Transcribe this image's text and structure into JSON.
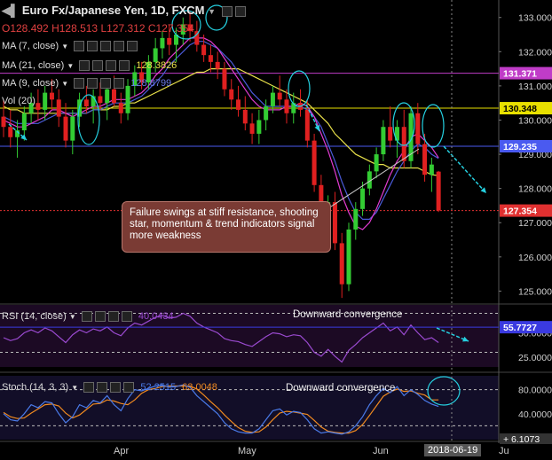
{
  "header": {
    "symbol": "Euro Fx/Japanese Yen, 1D, FXCM",
    "ohlc": {
      "o": "O128.492",
      "h": "H128.513",
      "l": "L127.312",
      "c": "C127.354"
    }
  },
  "indicators": {
    "ma7": {
      "label": "MA (7, close)",
      "color": "#e23bd1"
    },
    "ma21": {
      "label": "MA (21, close)",
      "value": "128.3826",
      "color": "#e8e04a"
    },
    "ma9": {
      "label": "MA (9, close)",
      "value": "128.8799",
      "color": "#4a5ad8"
    },
    "vol": {
      "label": "Vol (20)"
    }
  },
  "annotation_box": "Failure swings at stiff resistance, shooting star, momentum & trend indicators signal more weakness",
  "rsi_panel": {
    "label": "RSI (14, close)",
    "value": "40.0434",
    "caption": "Downward convergence",
    "tag": "55.7727",
    "ticks": [
      "50.0000",
      "25.0000"
    ]
  },
  "stoch_panel": {
    "label": "Stoch (14, 3, 3)",
    "k": "52.2515",
    "d": "63.0048",
    "caption": "Downward convergence",
    "ticks": [
      "80.0000",
      "40.0000"
    ],
    "tag": "6.1073"
  },
  "x_axis": {
    "labels": [
      "Apr",
      "May",
      "Jun",
      "Ju"
    ],
    "cursor_date": "2018-06-19"
  },
  "chart_data": {
    "type": "line",
    "title": "Euro Fx/Japanese Yen, 1D, FXCM",
    "y_ticks": [
      "133.000",
      "132.000",
      "131.000",
      "130.000",
      "129.000",
      "128.000",
      "127.000",
      "126.000",
      "125.000"
    ],
    "ylim": [
      124.7,
      133.2
    ],
    "levels": [
      {
        "label": "131.371",
        "value": 131.371,
        "color": "#c03cc8"
      },
      {
        "label": "130.348",
        "value": 130.348,
        "color": "#e8e000"
      },
      {
        "label": "129.235",
        "value": 129.235,
        "color": "#4a5af0"
      },
      {
        "label": "127.354",
        "value": 127.354,
        "color": "#e03030"
      }
    ],
    "candles": [
      {
        "o": 130.1,
        "h": 130.6,
        "l": 129.5,
        "c": 129.8
      },
      {
        "o": 129.8,
        "h": 130.3,
        "l": 129.2,
        "c": 129.5
      },
      {
        "o": 129.5,
        "h": 130.0,
        "l": 128.9,
        "c": 129.7
      },
      {
        "o": 129.7,
        "h": 130.4,
        "l": 129.4,
        "c": 130.2
      },
      {
        "o": 130.2,
        "h": 130.8,
        "l": 129.9,
        "c": 130.5
      },
      {
        "o": 130.5,
        "h": 130.9,
        "l": 130.0,
        "c": 130.3
      },
      {
        "o": 130.3,
        "h": 131.0,
        "l": 130.0,
        "c": 130.8
      },
      {
        "o": 130.8,
        "h": 131.2,
        "l": 130.3,
        "c": 130.6
      },
      {
        "o": 130.6,
        "h": 130.9,
        "l": 129.8,
        "c": 130.1
      },
      {
        "o": 130.1,
        "h": 130.5,
        "l": 129.2,
        "c": 129.4
      },
      {
        "o": 129.4,
        "h": 130.3,
        "l": 129.0,
        "c": 130.1
      },
      {
        "o": 130.1,
        "h": 130.8,
        "l": 129.8,
        "c": 130.6
      },
      {
        "o": 130.6,
        "h": 131.0,
        "l": 130.2,
        "c": 130.4
      },
      {
        "o": 130.4,
        "h": 130.9,
        "l": 129.9,
        "c": 130.7
      },
      {
        "o": 130.7,
        "h": 131.1,
        "l": 130.3,
        "c": 130.5
      },
      {
        "o": 130.5,
        "h": 131.0,
        "l": 130.0,
        "c": 130.9
      },
      {
        "o": 130.9,
        "h": 131.3,
        "l": 130.4,
        "c": 130.5
      },
      {
        "o": 130.5,
        "h": 130.8,
        "l": 129.9,
        "c": 130.2
      },
      {
        "o": 130.2,
        "h": 131.2,
        "l": 130.0,
        "c": 131.0
      },
      {
        "o": 131.0,
        "h": 131.6,
        "l": 130.7,
        "c": 131.4
      },
      {
        "o": 131.4,
        "h": 131.7,
        "l": 130.9,
        "c": 131.1
      },
      {
        "o": 131.1,
        "h": 131.9,
        "l": 130.9,
        "c": 131.7
      },
      {
        "o": 131.7,
        "h": 132.4,
        "l": 131.4,
        "c": 132.1
      },
      {
        "o": 132.1,
        "h": 132.6,
        "l": 131.8,
        "c": 132.4
      },
      {
        "o": 132.4,
        "h": 132.8,
        "l": 131.9,
        "c": 132.2
      },
      {
        "o": 132.2,
        "h": 132.7,
        "l": 131.7,
        "c": 132.5
      },
      {
        "o": 132.5,
        "h": 133.0,
        "l": 132.2,
        "c": 132.8
      },
      {
        "o": 132.8,
        "h": 133.2,
        "l": 132.3,
        "c": 132.6
      },
      {
        "o": 132.6,
        "h": 132.9,
        "l": 132.0,
        "c": 132.2
      },
      {
        "o": 132.2,
        "h": 132.5,
        "l": 131.7,
        "c": 131.9
      },
      {
        "o": 131.9,
        "h": 132.2,
        "l": 131.4,
        "c": 131.7
      },
      {
        "o": 131.7,
        "h": 132.0,
        "l": 131.2,
        "c": 131.5
      },
      {
        "o": 131.5,
        "h": 131.7,
        "l": 130.7,
        "c": 130.9
      },
      {
        "o": 130.9,
        "h": 131.2,
        "l": 130.3,
        "c": 130.6
      },
      {
        "o": 130.6,
        "h": 131.0,
        "l": 130.1,
        "c": 130.3
      },
      {
        "o": 130.3,
        "h": 130.7,
        "l": 129.7,
        "c": 129.9
      },
      {
        "o": 129.9,
        "h": 130.2,
        "l": 129.3,
        "c": 129.6
      },
      {
        "o": 129.6,
        "h": 130.3,
        "l": 129.3,
        "c": 130.0
      },
      {
        "o": 130.0,
        "h": 130.6,
        "l": 129.7,
        "c": 130.4
      },
      {
        "o": 130.4,
        "h": 131.0,
        "l": 130.2,
        "c": 130.8
      },
      {
        "o": 130.8,
        "h": 131.3,
        "l": 130.4,
        "c": 130.6
      },
      {
        "o": 130.6,
        "h": 130.9,
        "l": 129.9,
        "c": 130.2
      },
      {
        "o": 130.2,
        "h": 130.8,
        "l": 129.9,
        "c": 130.5
      },
      {
        "o": 130.5,
        "h": 130.9,
        "l": 130.1,
        "c": 130.3
      },
      {
        "o": 130.3,
        "h": 130.6,
        "l": 129.2,
        "c": 129.4
      },
      {
        "o": 129.4,
        "h": 129.6,
        "l": 127.9,
        "c": 128.1
      },
      {
        "o": 128.1,
        "h": 128.4,
        "l": 126.9,
        "c": 127.2
      },
      {
        "o": 127.2,
        "h": 127.8,
        "l": 126.6,
        "c": 127.6
      },
      {
        "o": 127.6,
        "h": 127.9,
        "l": 126.2,
        "c": 126.4
      },
      {
        "o": 126.4,
        "h": 126.7,
        "l": 124.8,
        "c": 125.2
      },
      {
        "o": 125.2,
        "h": 127.0,
        "l": 125.0,
        "c": 126.8
      },
      {
        "o": 126.8,
        "h": 127.6,
        "l": 126.5,
        "c": 127.4
      },
      {
        "o": 127.4,
        "h": 128.2,
        "l": 127.2,
        "c": 128.0
      },
      {
        "o": 128.0,
        "h": 128.7,
        "l": 127.8,
        "c": 128.5
      },
      {
        "o": 128.5,
        "h": 129.2,
        "l": 128.3,
        "c": 129.0
      },
      {
        "o": 129.0,
        "h": 130.0,
        "l": 128.8,
        "c": 129.8
      },
      {
        "o": 129.8,
        "h": 130.4,
        "l": 129.2,
        "c": 129.4
      },
      {
        "o": 129.4,
        "h": 130.0,
        "l": 128.9,
        "c": 129.8
      },
      {
        "o": 129.8,
        "h": 130.3,
        "l": 128.6,
        "c": 128.8
      },
      {
        "o": 128.8,
        "h": 130.4,
        "l": 128.6,
        "c": 130.2
      },
      {
        "o": 130.2,
        "h": 130.5,
        "l": 129.0,
        "c": 129.3
      },
      {
        "o": 129.3,
        "h": 129.6,
        "l": 128.2,
        "c": 128.4
      },
      {
        "o": 128.4,
        "h": 128.9,
        "l": 127.9,
        "c": 128.7
      },
      {
        "o": 128.492,
        "h": 128.513,
        "l": 127.312,
        "c": 127.354
      }
    ],
    "ma7": [
      130.0,
      129.9,
      129.8,
      129.8,
      129.9,
      130.0,
      130.1,
      130.3,
      130.3,
      130.2,
      130.1,
      130.2,
      130.3,
      130.4,
      130.4,
      130.5,
      130.6,
      130.6,
      130.6,
      130.7,
      130.8,
      131.0,
      131.3,
      131.5,
      131.8,
      132.0,
      132.2,
      132.4,
      132.4,
      132.4,
      132.3,
      132.1,
      131.8,
      131.5,
      131.2,
      130.9,
      130.6,
      130.4,
      130.3,
      130.3,
      130.3,
      130.4,
      130.4,
      130.5,
      130.4,
      130.1,
      129.6,
      129.1,
      128.5,
      127.8,
      127.3,
      126.9,
      126.8,
      127.0,
      127.4,
      127.9,
      128.4,
      128.8,
      129.1,
      129.5,
      129.6,
      129.4,
      129.2,
      128.9
    ],
    "ma21": [
      130.4,
      130.3,
      130.3,
      130.2,
      130.2,
      130.2,
      130.2,
      130.2,
      130.2,
      130.2,
      130.2,
      130.2,
      130.2,
      130.3,
      130.3,
      130.3,
      130.4,
      130.4,
      130.5,
      130.5,
      130.6,
      130.7,
      130.8,
      130.9,
      131.0,
      131.1,
      131.2,
      131.3,
      131.4,
      131.4,
      131.5,
      131.5,
      131.5,
      131.5,
      131.5,
      131.4,
      131.3,
      131.2,
      131.1,
      131.0,
      130.9,
      130.8,
      130.7,
      130.6,
      130.5,
      130.3,
      130.1,
      129.9,
      129.6,
      129.4,
      129.2,
      129.0,
      128.9,
      128.8,
      128.7,
      128.7,
      128.6,
      128.6,
      128.6,
      128.6,
      128.6,
      128.5,
      128.4,
      128.38
    ],
    "ma9": [
      130.1,
      130.0,
      129.9,
      129.9,
      129.9,
      129.9,
      130.0,
      130.1,
      130.2,
      130.2,
      130.2,
      130.2,
      130.2,
      130.3,
      130.3,
      130.4,
      130.5,
      130.5,
      130.5,
      130.6,
      130.7,
      130.9,
      131.1,
      131.3,
      131.6,
      131.8,
      132.0,
      132.2,
      132.3,
      132.3,
      132.2,
      132.1,
      131.9,
      131.7,
      131.4,
      131.1,
      130.8,
      130.6,
      130.4,
      130.4,
      130.4,
      130.4,
      130.4,
      130.4,
      130.3,
      130.1,
      129.8,
      129.3,
      128.8,
      128.2,
      127.7,
      127.3,
      127.1,
      127.1,
      127.3,
      127.7,
      128.1,
      128.5,
      128.8,
      129.1,
      129.3,
      129.2,
      129.0,
      128.88
    ],
    "rsi": [
      45,
      42,
      44,
      50,
      53,
      50,
      55,
      52,
      46,
      40,
      48,
      53,
      50,
      54,
      52,
      56,
      50,
      47,
      55,
      60,
      58,
      62,
      66,
      68,
      65,
      66,
      70,
      67,
      60,
      56,
      53,
      50,
      44,
      42,
      41,
      38,
      36,
      41,
      46,
      50,
      49,
      46,
      48,
      47,
      40,
      30,
      26,
      33,
      26,
      20,
      32,
      38,
      45,
      50,
      55,
      60,
      52,
      56,
      48,
      58,
      50,
      43,
      45,
      40
    ],
    "stoch_k": [
      40,
      30,
      28,
      40,
      55,
      50,
      60,
      58,
      40,
      25,
      35,
      55,
      50,
      62,
      58,
      70,
      55,
      45,
      65,
      80,
      78,
      82,
      86,
      88,
      84,
      85,
      88,
      84,
      70,
      60,
      50,
      40,
      25,
      15,
      10,
      8,
      8,
      15,
      30,
      45,
      48,
      38,
      44,
      42,
      30,
      15,
      8,
      10,
      8,
      6,
      10,
      20,
      35,
      55,
      70,
      82,
      75,
      85,
      70,
      80,
      72,
      62,
      56,
      52
    ],
    "stoch_d": [
      42,
      35,
      32,
      33,
      41,
      48,
      55,
      56,
      53,
      41,
      33,
      38,
      47,
      56,
      57,
      63,
      61,
      57,
      55,
      63,
      74,
      80,
      82,
      85,
      86,
      86,
      86,
      86,
      81,
      71,
      60,
      50,
      38,
      27,
      17,
      11,
      9,
      10,
      18,
      30,
      41,
      44,
      43,
      41,
      39,
      29,
      18,
      11,
      9,
      8,
      8,
      12,
      22,
      37,
      53,
      69,
      76,
      81,
      77,
      78,
      74,
      71,
      63,
      63
    ]
  }
}
